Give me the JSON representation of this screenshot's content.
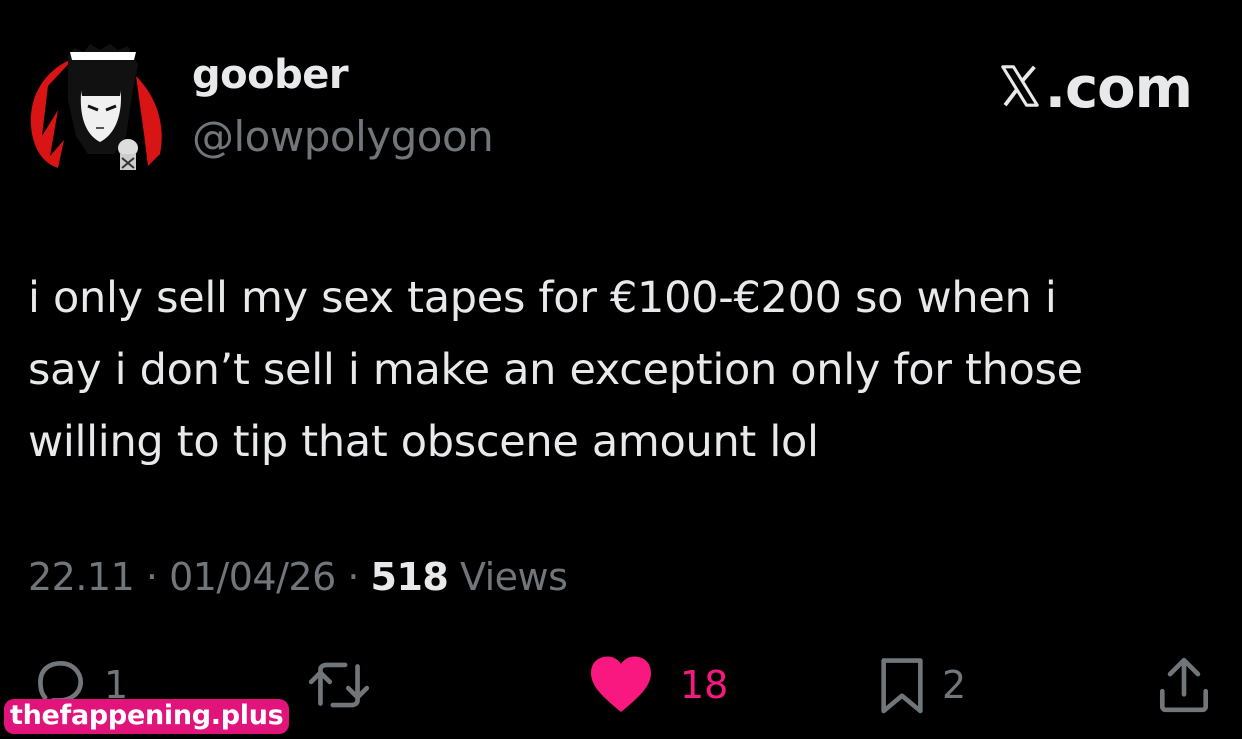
{
  "author": {
    "display_name": "goober",
    "handle": "@lowpolygoon",
    "avatar_icon": "avatar-icon"
  },
  "brand": {
    "label": ".com",
    "icon": "x-logo-icon"
  },
  "tweet": {
    "lines": [
      "i only sell my sex tapes for €100-€200 so when i",
      "say i don’t sell i make an exception only for those",
      "willing to tip that obscene amount lol"
    ]
  },
  "meta": {
    "time": "22.11",
    "separator": "·",
    "date": "01/04/26",
    "views_count": "518",
    "views_label": "Views"
  },
  "actions": {
    "reply": {
      "icon": "reply-icon",
      "count": "1"
    },
    "retweet": {
      "icon": "retweet-icon",
      "count": ""
    },
    "like": {
      "icon": "heart-icon",
      "count": "18",
      "color": "#f91880"
    },
    "bookmark": {
      "icon": "bookmark-icon",
      "count": "2"
    },
    "share": {
      "icon": "share-icon",
      "count": ""
    }
  },
  "watermark": {
    "text": "thefappening.plus",
    "color": "#e0147a"
  }
}
